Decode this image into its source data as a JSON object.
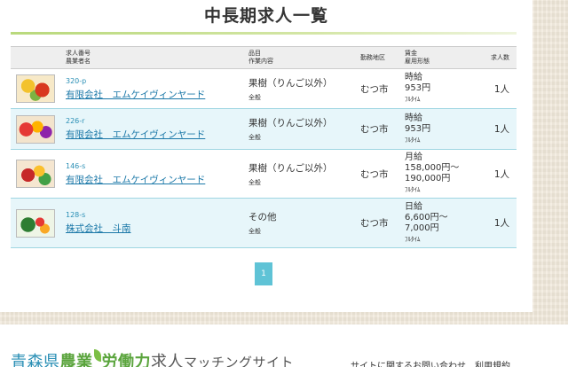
{
  "page": {
    "title": "中長期求人一覧"
  },
  "table": {
    "headers": {
      "job_number": "求人番号",
      "farm_name": "農業者名",
      "item": "品目",
      "work_content": "作業内容",
      "area": "勤務地区",
      "wage": "賃金",
      "employment_type": "雇用形態",
      "openings": "求人数"
    },
    "rows": [
      {
        "number": "320-p",
        "farm": "有限会社　エムケイヴィンヤード",
        "crop": "果樹（りんご以外）",
        "work": "全般",
        "area": "むつ市",
        "wage": [
          "時給",
          "953円"
        ],
        "employment": "ﾌﾙﾀｲﾑ",
        "count": "1人",
        "thumb": "fruit-photo-icon"
      },
      {
        "number": "226-r",
        "farm": "有限会社　エムケイヴィンヤード",
        "crop": "果樹（りんご以外）",
        "work": "全般",
        "area": "むつ市",
        "wage": [
          "時給",
          "953円"
        ],
        "employment": "ﾌﾙﾀｲﾑ",
        "count": "1人",
        "thumb": "fruit-photo-icon"
      },
      {
        "number": "146-s",
        "farm": "有限会社　エムケイヴィンヤード",
        "crop": "果樹（りんご以外）",
        "work": "全般",
        "area": "むつ市",
        "wage": [
          "月給",
          "158,000円～",
          "190,000円"
        ],
        "employment": "ﾌﾙﾀｲﾑ",
        "count": "1人",
        "thumb": "fruit-photo-icon"
      },
      {
        "number": "128-s",
        "farm": "株式会社　斗南",
        "crop": "その他",
        "work": "全般",
        "area": "むつ市",
        "wage": [
          "日給",
          "6,600円～",
          "7,000円"
        ],
        "employment": "ﾌﾙﾀｲﾑ",
        "count": "1人",
        "thumb": "vegetable-photo-icon"
      }
    ]
  },
  "pagination": {
    "current": "1"
  },
  "footer": {
    "logo_part1": "青森県",
    "logo_part2": "農業",
    "logo_part3": "労働力",
    "logo_part4": "求人",
    "logo_part5": "マッチングサイト",
    "links": "サイトに関するお問い合わせ　利用規約"
  },
  "colors": {
    "accent": "#5fc3d6",
    "link": "#1b78a8",
    "row_alt": "#e7f6fa",
    "rule": "#b9d97c"
  }
}
